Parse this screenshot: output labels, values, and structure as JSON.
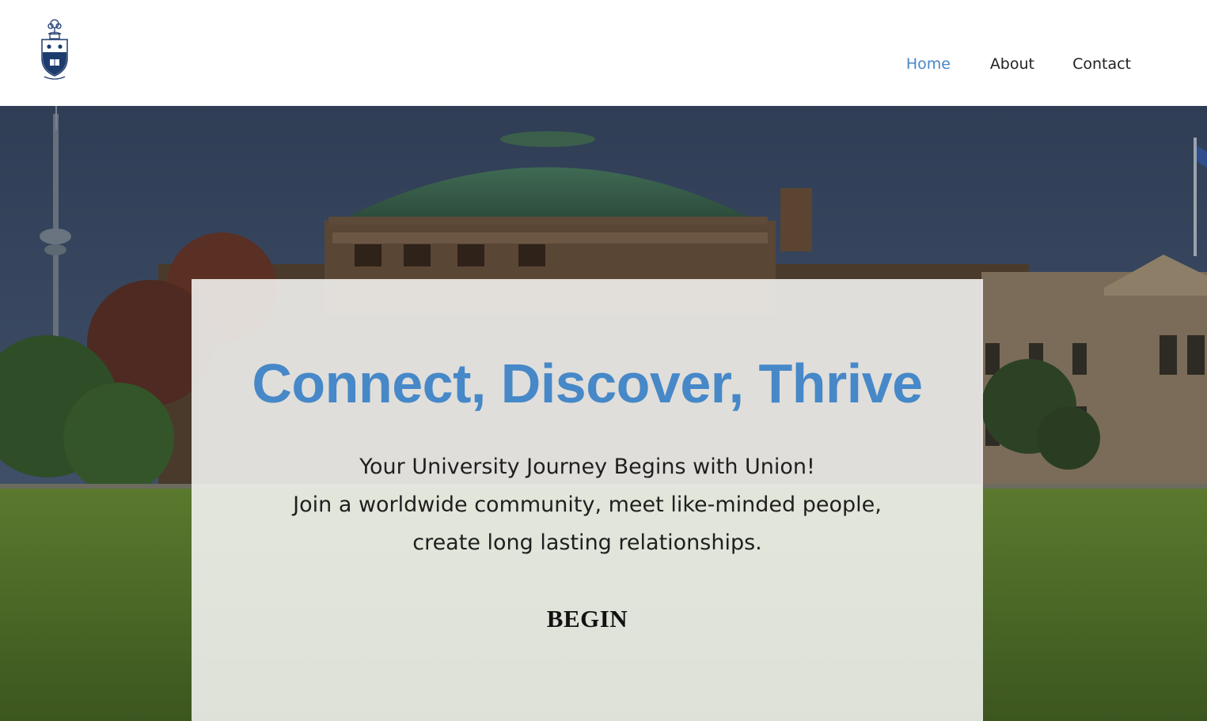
{
  "nav": {
    "items": [
      {
        "label": "Home",
        "active": true
      },
      {
        "label": "About",
        "active": false
      },
      {
        "label": "Contact",
        "active": false
      }
    ]
  },
  "logo": {
    "icon": "university-crest-icon"
  },
  "hero": {
    "background": "campus-convocation-hall-photo",
    "headline": "Connect, Discover, Thrive",
    "subtitle_line1": "Your University Journey Begins with Union!",
    "subtitle_line2": "Join a worldwide community, meet like-minded people,",
    "subtitle_line3": "create long lasting relationships.",
    "cta_label": "BEGIN"
  },
  "colors": {
    "accent": "#4688c8",
    "nav_active": "#4a86c6",
    "text": "#222222"
  }
}
